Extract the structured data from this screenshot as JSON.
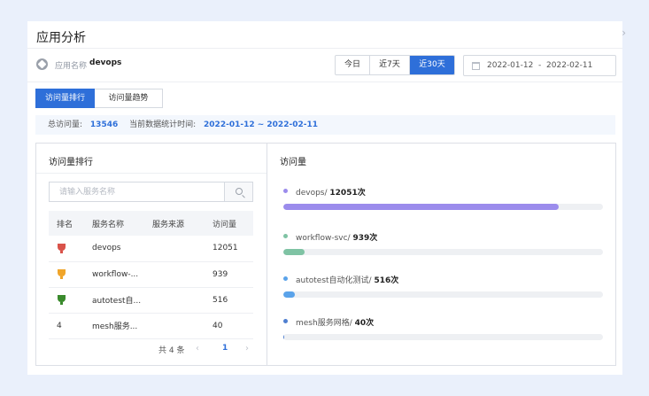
{
  "title": "应用分析",
  "app": {
    "label": "应用名称",
    "value": "devops"
  },
  "range": {
    "buttons": [
      {
        "label": "今日",
        "active": false
      },
      {
        "label": "近7天",
        "active": false
      },
      {
        "label": "近30天",
        "active": true
      }
    ]
  },
  "date_range": {
    "start": "2022-01-12",
    "separator": "-",
    "end": "2022-02-11"
  },
  "tabs": [
    {
      "label": "访问量排行",
      "active": true
    },
    {
      "label": "访问量趋势",
      "active": false
    }
  ],
  "summary": {
    "total_label": "总访问量:",
    "total_value": "13546",
    "period_label": "当前数据统计时间:",
    "period_value": "2022-01-12 ~ 2022-02-11"
  },
  "ranking": {
    "title": "访问量排行",
    "search_placeholder": "请输入服务名称",
    "columns": [
      "排名",
      "服务名称",
      "服务来源",
      "访问量"
    ],
    "rows": [
      {
        "rank": "",
        "trophy": "red",
        "name": "devops",
        "source": "",
        "visits": "12051"
      },
      {
        "rank": "",
        "trophy": "orange",
        "name": "workflow-...",
        "source": "",
        "visits": "939"
      },
      {
        "rank": "",
        "trophy": "green",
        "name": "autotest自...",
        "source": "",
        "visits": "516"
      },
      {
        "rank": "4",
        "trophy": "",
        "name": "mesh服务...",
        "source": "",
        "visits": "40"
      }
    ],
    "pager": {
      "total_text": "共 4 条",
      "prev": "‹",
      "page": "1",
      "next": "›"
    }
  },
  "visits": {
    "title": "访问量",
    "max": 14000,
    "items": [
      {
        "name": "devops/",
        "count": "12051次",
        "value": 12051,
        "color": "#9b8cec"
      },
      {
        "name": "workflow-svc/",
        "count": "939次",
        "value": 939,
        "color": "#7fc3a4"
      },
      {
        "name": "autotest自动化测试/",
        "count": "516次",
        "value": 516,
        "color": "#5aa3ea"
      },
      {
        "name": "mesh服务网格/",
        "count": "40次",
        "value": 40,
        "color": "#4f7fd0"
      }
    ]
  }
}
